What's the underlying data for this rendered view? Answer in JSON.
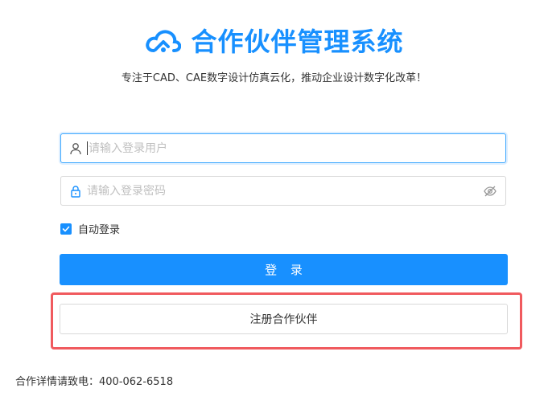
{
  "header": {
    "title": "合作伙伴管理系统",
    "subtitle": "专注于CAD、CAE数字设计仿真云化，推动企业设计数字化改革！",
    "logo_icon": "cloud-logo-icon"
  },
  "login_form": {
    "username": {
      "value": "",
      "placeholder": "请输入登录用户",
      "icon": "user-icon"
    },
    "password": {
      "value": "",
      "placeholder": "请输入登录密码",
      "icon": "lock-icon",
      "toggle_icon": "eye-hidden-icon"
    },
    "remember": {
      "label": "自动登录",
      "checked": true
    },
    "login_label": "登 录",
    "register_label": "注册合作伙伴"
  },
  "footer": {
    "contact_text": "合作详情请致电：400-062-6518"
  },
  "colors": {
    "primary": "#1890ff",
    "highlight": "#f05a5e",
    "border": "#d9d9d9",
    "placeholder": "#bfbfbf"
  }
}
